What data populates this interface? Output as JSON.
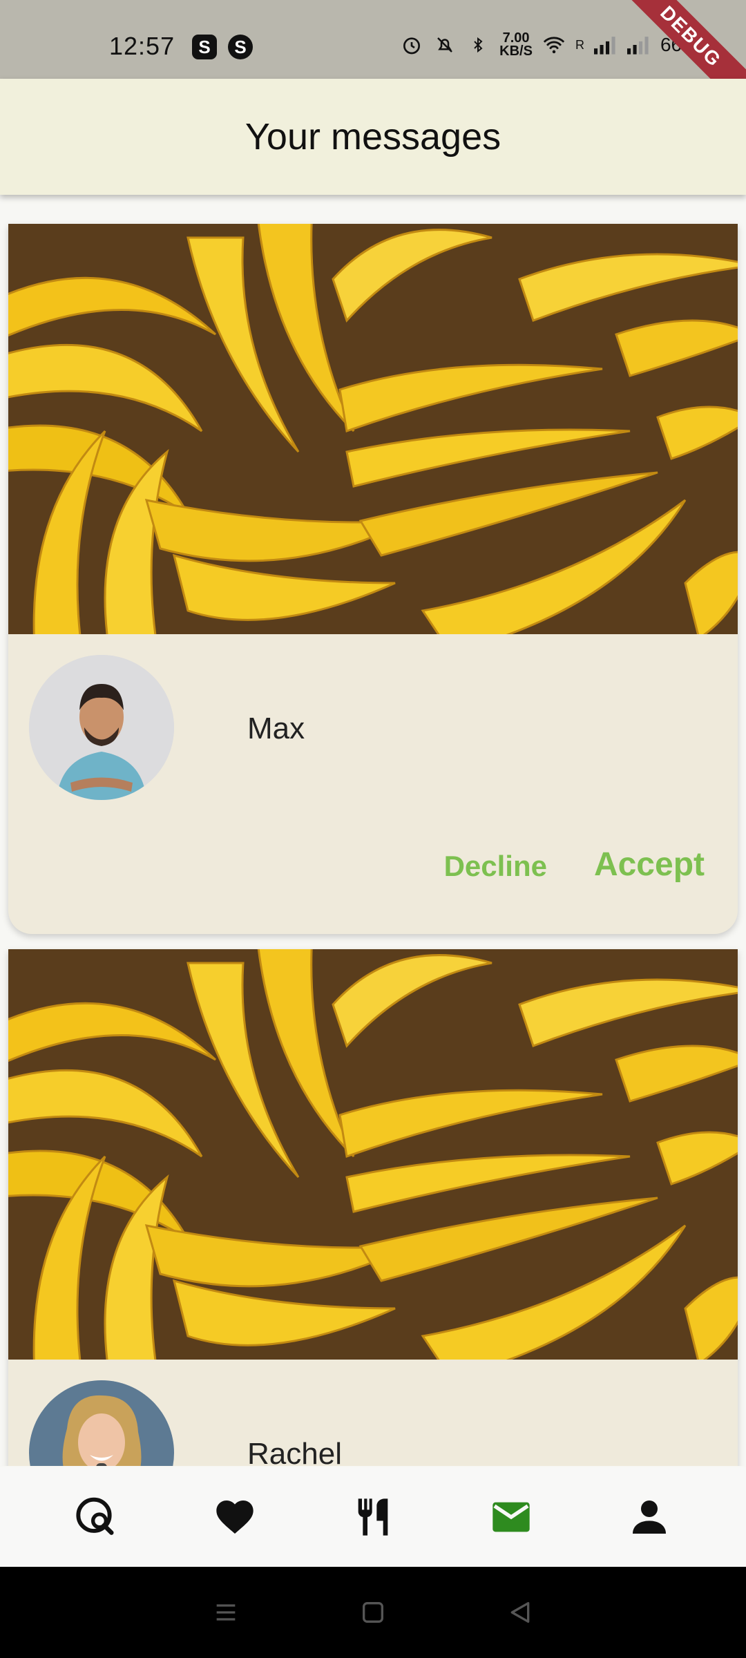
{
  "status_bar": {
    "time": "12:57",
    "app_icons": [
      "S",
      "S"
    ],
    "net_speed_value": "7.00",
    "net_speed_unit": "KB/S",
    "roaming": "R",
    "battery": "66%",
    "debug_label": "DEBUG"
  },
  "header": {
    "title": "Your messages"
  },
  "messages": [
    {
      "name": "Max",
      "decline_label": "Decline",
      "accept_label": "Accept"
    },
    {
      "name": "Rachel"
    }
  ],
  "bottom_nav": {
    "items": [
      "explore-icon",
      "heart-icon",
      "restaurant-icon",
      "mail-icon",
      "person-icon"
    ],
    "active_index": 3,
    "active_color": "#2e8b1f",
    "inactive_color": "#111111"
  },
  "accent_color": "#7dc050"
}
